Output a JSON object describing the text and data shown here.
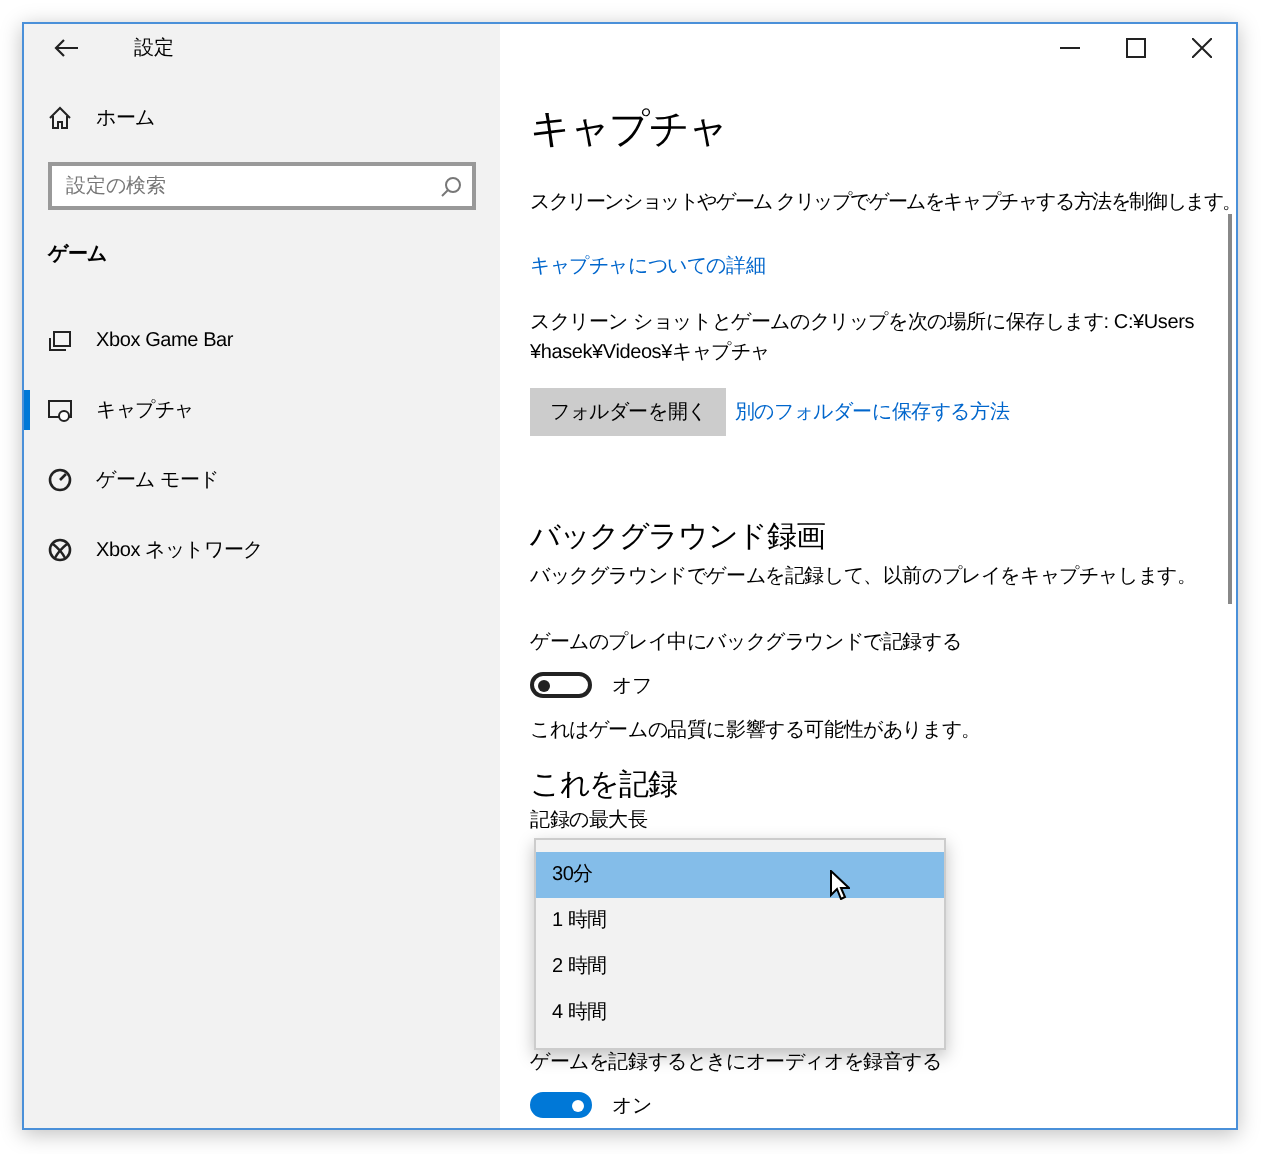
{
  "window": {
    "title": "設定"
  },
  "sidebar": {
    "home": "ホーム",
    "search": {
      "placeholder": "設定の検索"
    },
    "section": "ゲーム",
    "items": [
      {
        "label": "Xbox Game Bar",
        "selected": false
      },
      {
        "label": "キャプチャ",
        "selected": true
      },
      {
        "label": "ゲーム モード",
        "selected": false
      },
      {
        "label": "Xbox ネットワーク",
        "selected": false
      }
    ]
  },
  "page": {
    "title": "キャプチャ",
    "description": "スクリーンショットやゲーム クリップでゲームをキャプチャする方法を制御します。",
    "details_link": "キャプチャについての詳細",
    "save_location": [
      "スクリーン ショットとゲームのクリップを次の場所に保存します: C:¥Users",
      "¥hasek¥Videos¥キャプチャ"
    ],
    "open_folder_button": "フォルダーを開く",
    "other_folder_link": "別のフォルダーに保存する方法",
    "background": {
      "heading": "バックグラウンド録画",
      "description": "バックグラウンドでゲームを記録して、以前のプレイをキャプチャします。",
      "toggle": {
        "label": "ゲームのプレイ中にバックグラウンドで記録する",
        "on": false,
        "state_text": "オフ"
      },
      "note": "これはゲームの品質に影響する可能性があります。"
    },
    "record": {
      "heading": "これを記録",
      "max_length_label": "記録の最大長",
      "dropdown": [
        {
          "label": "30分",
          "selected": true
        },
        {
          "label": "1 時間",
          "selected": false
        },
        {
          "label": "2 時間",
          "selected": false
        },
        {
          "label": "4 時間",
          "selected": false
        }
      ],
      "audio_toggle": {
        "label": "ゲームを記録するときにオーディオを録音する",
        "on": true,
        "state_text": "オン"
      }
    }
  }
}
